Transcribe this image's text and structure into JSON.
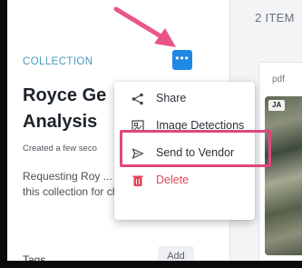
{
  "collection": {
    "eyebrow": "COLLECTION",
    "more_button_label": "•••",
    "title_line1": "Royce Ge",
    "title_line2": "Analysis",
    "created": "Created a few seco",
    "description": "Requesting Roy ... the images in this collection for change detection.",
    "tags_label": "Tags",
    "add_label": "Add"
  },
  "items_panel": {
    "count_label": "2 ITEM",
    "item_type": "pdf",
    "thumb_tag": "JA"
  },
  "menu": {
    "items": [
      {
        "label": "Share",
        "icon": "share-icon"
      },
      {
        "label": "Image Detections",
        "icon": "image-detections-icon"
      },
      {
        "label": "Send to Vendor",
        "icon": "send-icon",
        "highlighted": true
      },
      {
        "label": "Delete",
        "icon": "trash-icon",
        "danger": true
      }
    ]
  },
  "colors": {
    "accent": "#1e88e5",
    "eyebrow": "#4a9bb8",
    "danger": "#e0455a",
    "annotation": "#e0467e"
  }
}
